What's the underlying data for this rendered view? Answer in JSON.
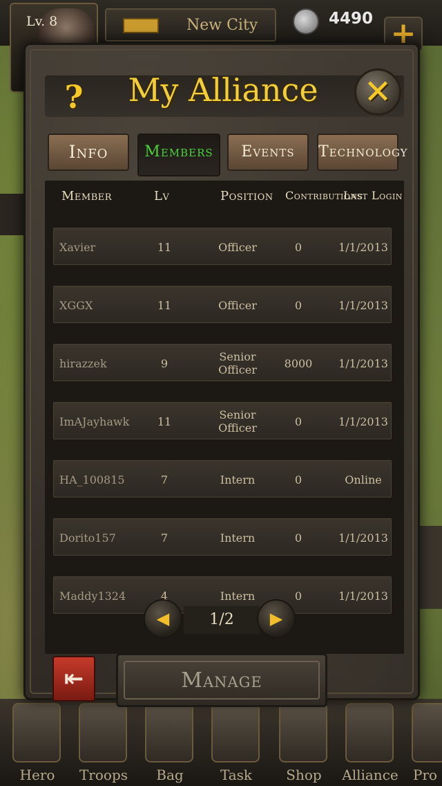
{
  "topbar": {
    "level": "Lv. 8",
    "city": "New City",
    "coins": "4490",
    "plus": "+"
  },
  "dialog": {
    "help": "?",
    "title": "My Alliance",
    "close": "✕",
    "tabs": [
      {
        "label": "Info",
        "active": false
      },
      {
        "label": "Members",
        "active": true
      },
      {
        "label": "Events",
        "active": false
      },
      {
        "label": "Technology",
        "active": false
      }
    ],
    "columns": [
      "Member",
      "Lv",
      "Position",
      "Contributions",
      "Last Login"
    ],
    "rows": [
      {
        "member": "Xavier",
        "lv": "11",
        "position": "Officer",
        "contribution": "0",
        "last_login": "1/1/2013"
      },
      {
        "member": "XGGX",
        "lv": "11",
        "position": "Officer",
        "contribution": "0",
        "last_login": "1/1/2013"
      },
      {
        "member": "hirazzek",
        "lv": "9",
        "position": "Senior Officer",
        "contribution": "8000",
        "last_login": "1/1/2013"
      },
      {
        "member": "ImAJayhawk",
        "lv": "11",
        "position": "Senior Officer",
        "contribution": "0",
        "last_login": "1/1/2013"
      },
      {
        "member": "HA_100815",
        "lv": "7",
        "position": "Intern",
        "contribution": "0",
        "last_login": "Online"
      },
      {
        "member": "Dorito157",
        "lv": "7",
        "position": "Intern",
        "contribution": "0",
        "last_login": "1/1/2013"
      },
      {
        "member": "Maddy1324",
        "lv": "4",
        "position": "Intern",
        "contribution": "0",
        "last_login": "1/1/2013"
      }
    ],
    "pager": {
      "text": "1/2",
      "prev": "◀",
      "next": "▶"
    },
    "exit": "⇤",
    "manage": "Manage"
  },
  "bottomnav": [
    {
      "label": "Hero"
    },
    {
      "label": "Troops"
    },
    {
      "label": "Bag"
    },
    {
      "label": "Task"
    },
    {
      "label": "Shop"
    },
    {
      "label": "Alliance"
    },
    {
      "label": "Pro"
    }
  ],
  "colors": {
    "accent": "#f2cf3a",
    "active_tab": "#4bd33c",
    "exit": "#c53a2a"
  }
}
